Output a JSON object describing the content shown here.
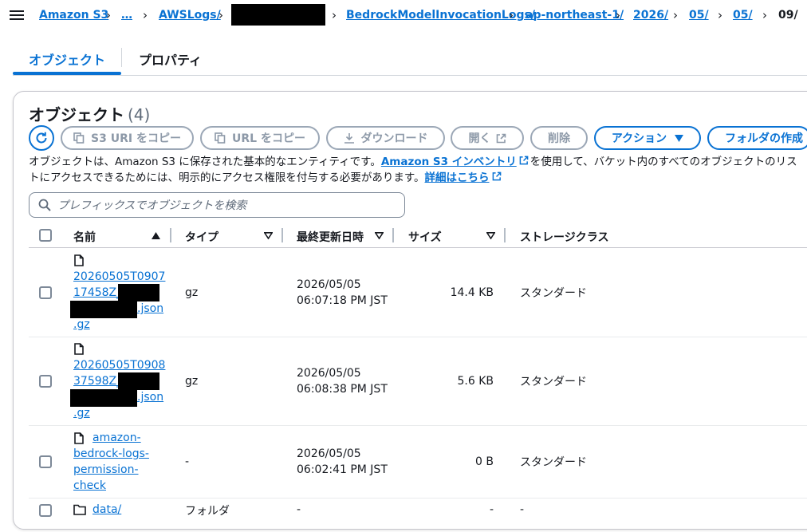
{
  "breadcrumb": {
    "items": [
      "Amazon S3",
      "…",
      "AWSLogs/",
      "BedrockModelInvocationLogs/",
      "ap-northeast-1/",
      "2026/",
      "05/",
      "05/",
      "09/"
    ]
  },
  "tabs": [
    "オブジェクト",
    "プロパティ"
  ],
  "panel": {
    "title": "オブジェクト",
    "count": "(4)",
    "toolbar": {
      "copy_s3_uri": "S3 URI をコピー",
      "copy_url": "URL をコピー",
      "download": "ダウンロード",
      "open": "開く",
      "delete": "削除",
      "actions": "アクション",
      "create_folder": "フォルダの作成"
    },
    "description": {
      "part1": "オブジェクトは、Amazon S3 に保存された基本的なエンティティです。",
      "link1": "Amazon S3 インベントリ",
      "part2": "を使用して、バケット内のすべてのオブジェクトのリス",
      "part3": "トにアクセスできるためには、明示的にアクセス権限を付与する必要があります。",
      "link2": "詳細はこちら"
    },
    "search_placeholder": "プレフィックスでオブジェクトを検索"
  },
  "table": {
    "columns": [
      "名前",
      "タイプ",
      "最終更新日時",
      "サイズ",
      "ストレージクラス"
    ],
    "rows": [
      {
        "name_l1": "20260505T0907",
        "name_l2": "17458Z_",
        "name_l3": ".json",
        "name_l4": ".gz",
        "type": "gz",
        "date": "2026/05/05",
        "time": "06:07:18 PM JST",
        "size": "14.4 KB",
        "storage": "スタンダード"
      },
      {
        "name_l1": "20260505T0908",
        "name_l2": "37598Z_",
        "name_l3": ".json",
        "name_l4": ".gz",
        "type": "gz",
        "date": "2026/05/05",
        "time": "06:08:38 PM JST",
        "size": "5.6 KB",
        "storage": "スタンダード"
      },
      {
        "name_l1": "amazon-",
        "name_l2": "bedrock-logs-",
        "name_l3": "permission-",
        "name_l4": "check",
        "type": "-",
        "date": "2026/05/05",
        "time": "06:02:41 PM JST",
        "size": "0 B",
        "storage": "スタンダード"
      },
      {
        "name": "data/",
        "type": "フォルダ",
        "modified": "-",
        "size": "-",
        "storage": "-"
      }
    ]
  },
  "colors": {
    "accent": "#0972d3",
    "disabled": "#8d99a8",
    "text": "#16191f"
  }
}
